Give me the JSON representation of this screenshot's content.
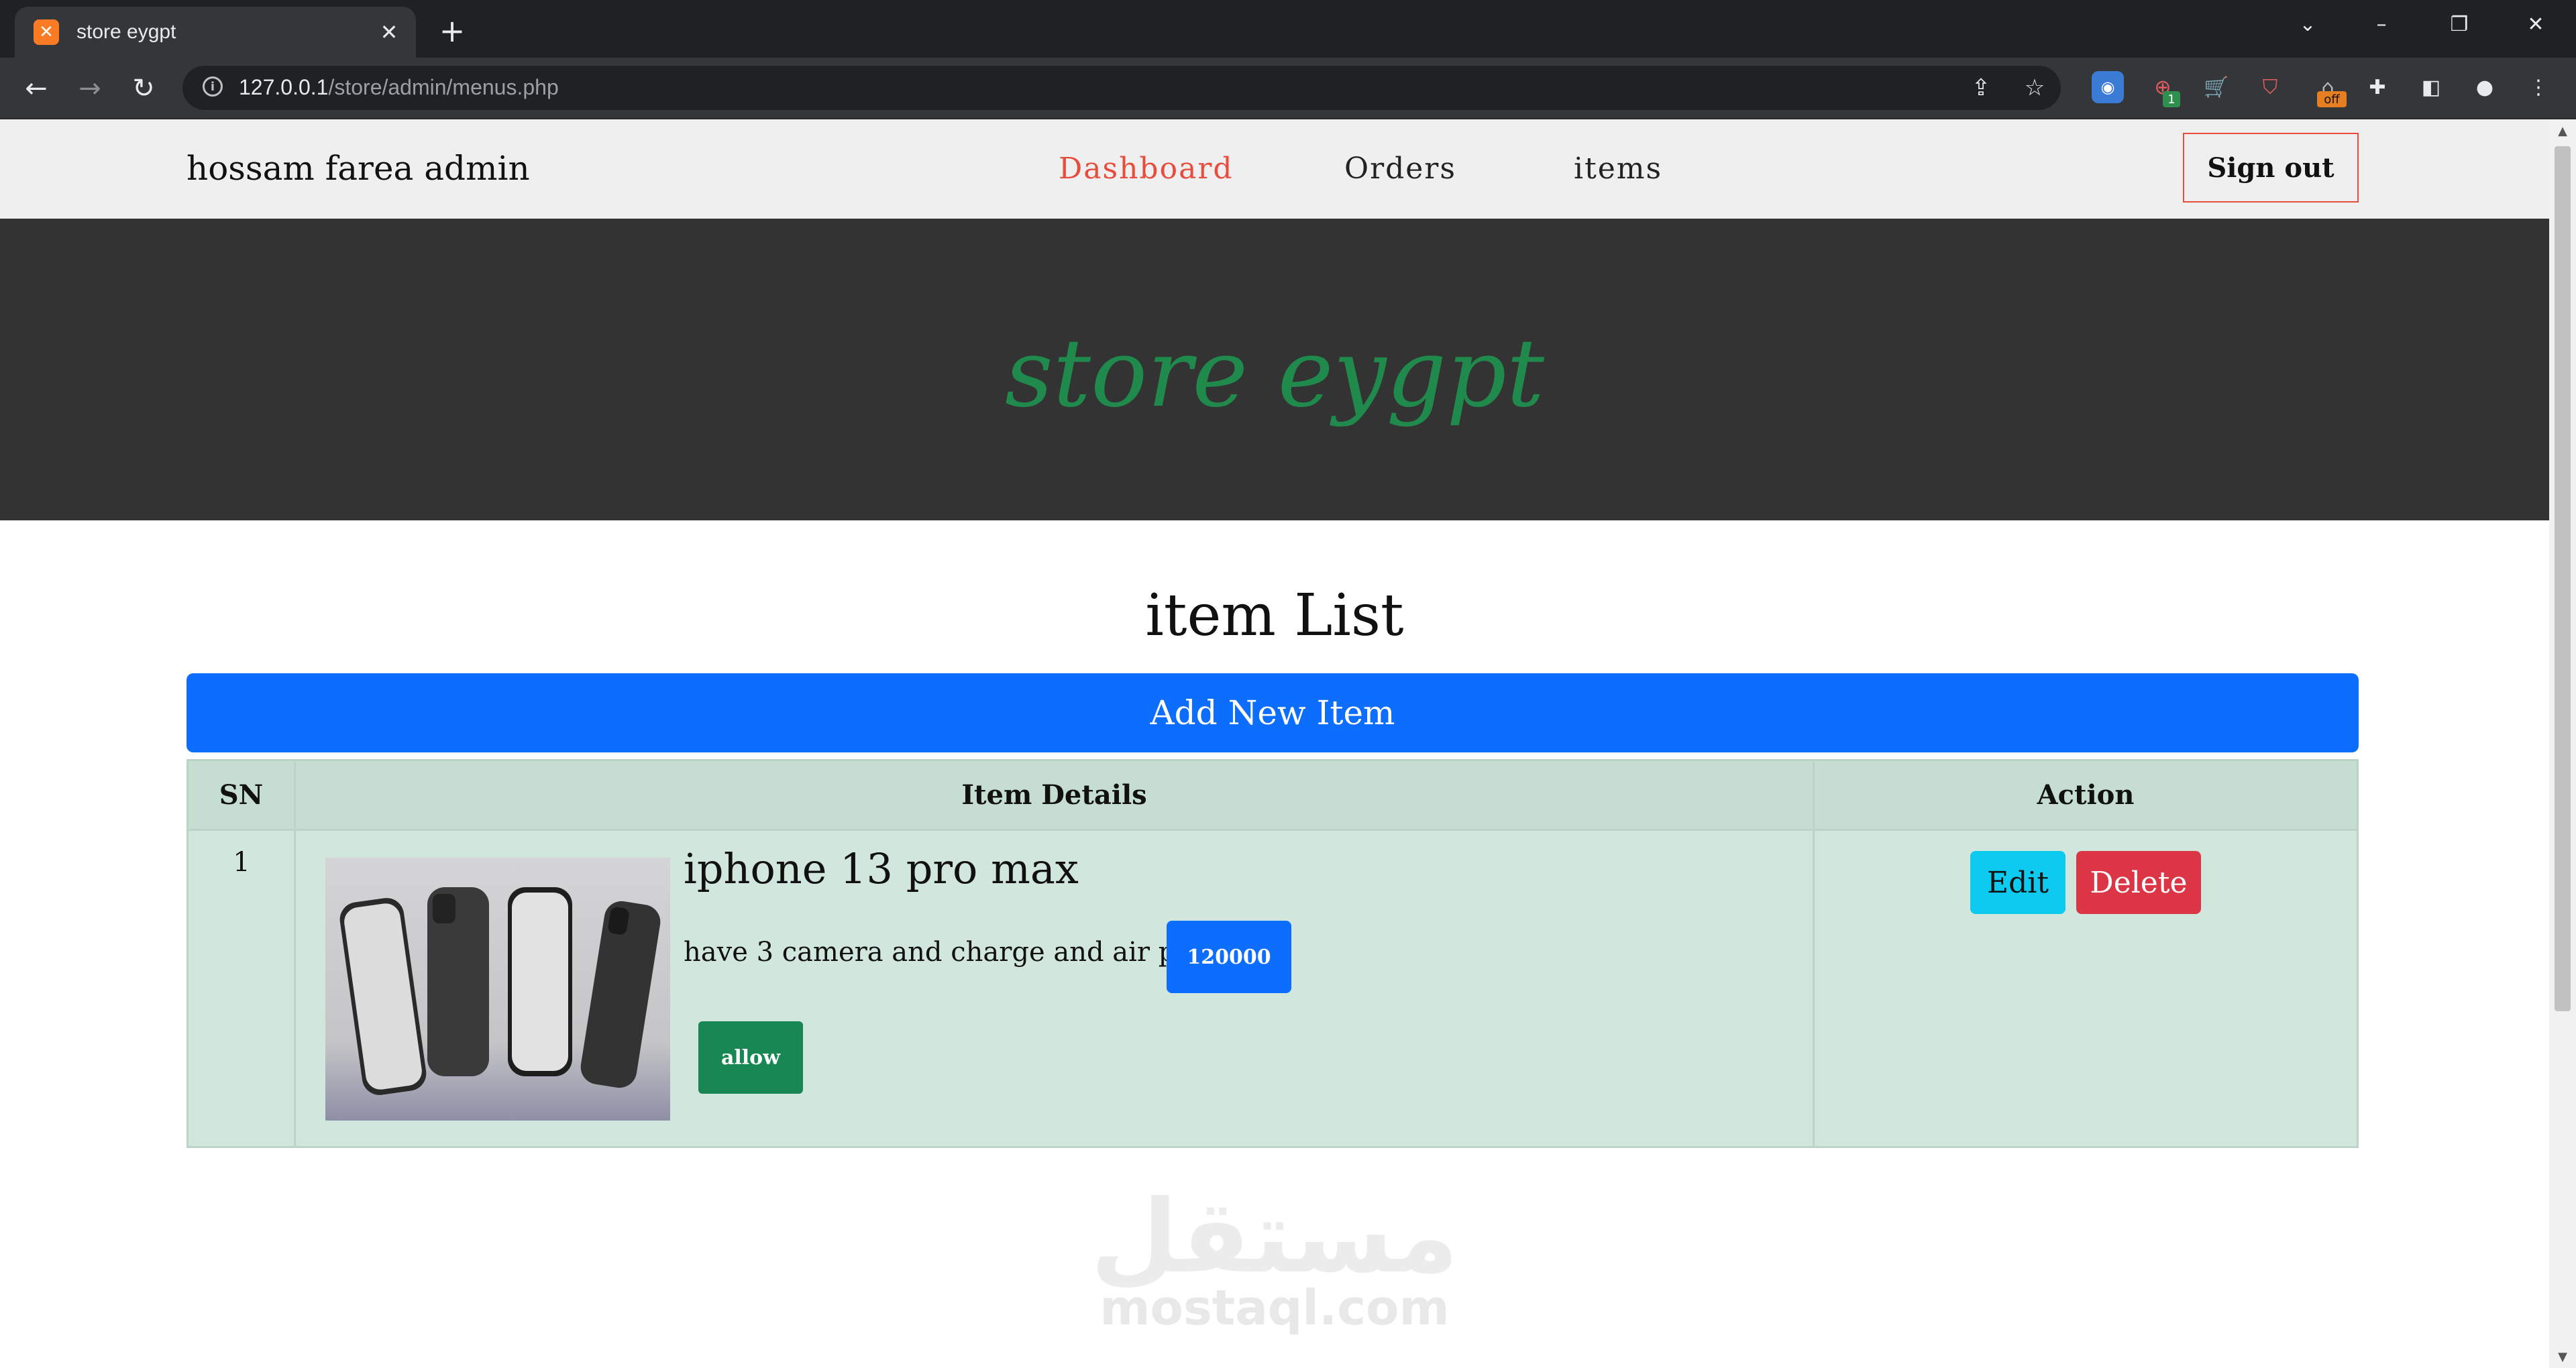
{
  "browser": {
    "tab_title": "store eygpt",
    "favicon": "xampp-icon",
    "url_host": "127.0.0.1",
    "url_path": "/store/admin/menus.php",
    "icons": [
      "back-icon",
      "forward-icon",
      "reload-icon",
      "share-icon",
      "bookmark-star-icon",
      "extensions-icon",
      "profile-icon",
      "menu-icon"
    ],
    "extension_badges": {
      "badge1": "1",
      "badge2": "off"
    }
  },
  "header": {
    "brand": "hossam farea admin",
    "nav": [
      {
        "label": "Dashboard",
        "active": true
      },
      {
        "label": "Orders",
        "active": false
      },
      {
        "label": "items",
        "active": false
      }
    ],
    "signout_label": "Sign out"
  },
  "hero": {
    "title": "store eygpt"
  },
  "main": {
    "list_title": "item List",
    "add_button_label": "Add New Item",
    "table": {
      "headers": [
        "SN",
        "Item Details",
        "Action"
      ],
      "rows": [
        {
          "sn": "1",
          "name": "iphone 13 pro max",
          "description": "have 3 camera and charge and air pot",
          "price": "120000",
          "status": "allow",
          "actions": {
            "edit": "Edit",
            "delete": "Delete"
          }
        }
      ]
    }
  },
  "watermark": {
    "arabic": "مستقل",
    "latin": "mostaql.com"
  },
  "colors": {
    "accent_active": "#e74c3c",
    "hero_title": "#1f8a4c",
    "primary": "#0d6efd",
    "success": "#198754",
    "info": "#0dcaf0",
    "danger": "#dc3545",
    "hero_bg": "#333333"
  }
}
